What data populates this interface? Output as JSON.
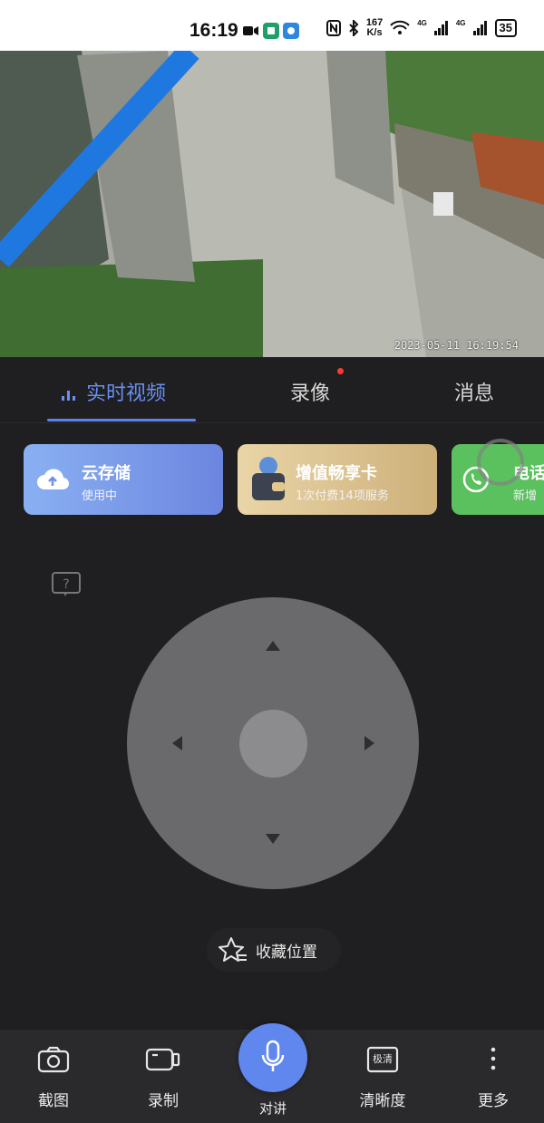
{
  "status_bar": {
    "time": "16:19",
    "network_speed_value": "167",
    "network_speed_unit": "K/s",
    "signal_label_1": "4G",
    "signal_label_2": "4G",
    "battery": "35"
  },
  "camera": {
    "timestamp": "2023-05-11 16:19:54"
  },
  "tabs": [
    {
      "label": "实时视频",
      "active": true
    },
    {
      "label": "录像",
      "active": false,
      "has_badge": true
    },
    {
      "label": "消息",
      "active": false
    }
  ],
  "cards": [
    {
      "title": "云存储",
      "subtitle": "使用中",
      "icon": "cloud-upload-icon",
      "color": "#6f8fe8"
    },
    {
      "title": "增值畅享卡",
      "subtitle": "1次付费14项服务",
      "icon": "wallet-icon",
      "color": "#d9bf86"
    },
    {
      "title": "电话",
      "subtitle": "新增",
      "icon": "phone-icon",
      "color": "#59c45e"
    }
  ],
  "ptz": {
    "help_icon": "question-icon"
  },
  "favorite": {
    "label": "收藏位置",
    "icon": "star-list-icon"
  },
  "toolbar": {
    "screenshot": "截图",
    "record": "录制",
    "talk": "对讲",
    "quality": "清晰度",
    "quality_badge": "极清",
    "more": "更多"
  },
  "colors": {
    "accent": "#5f87ee",
    "background": "#1f1f21",
    "recording_dot": "#ff3b30"
  }
}
